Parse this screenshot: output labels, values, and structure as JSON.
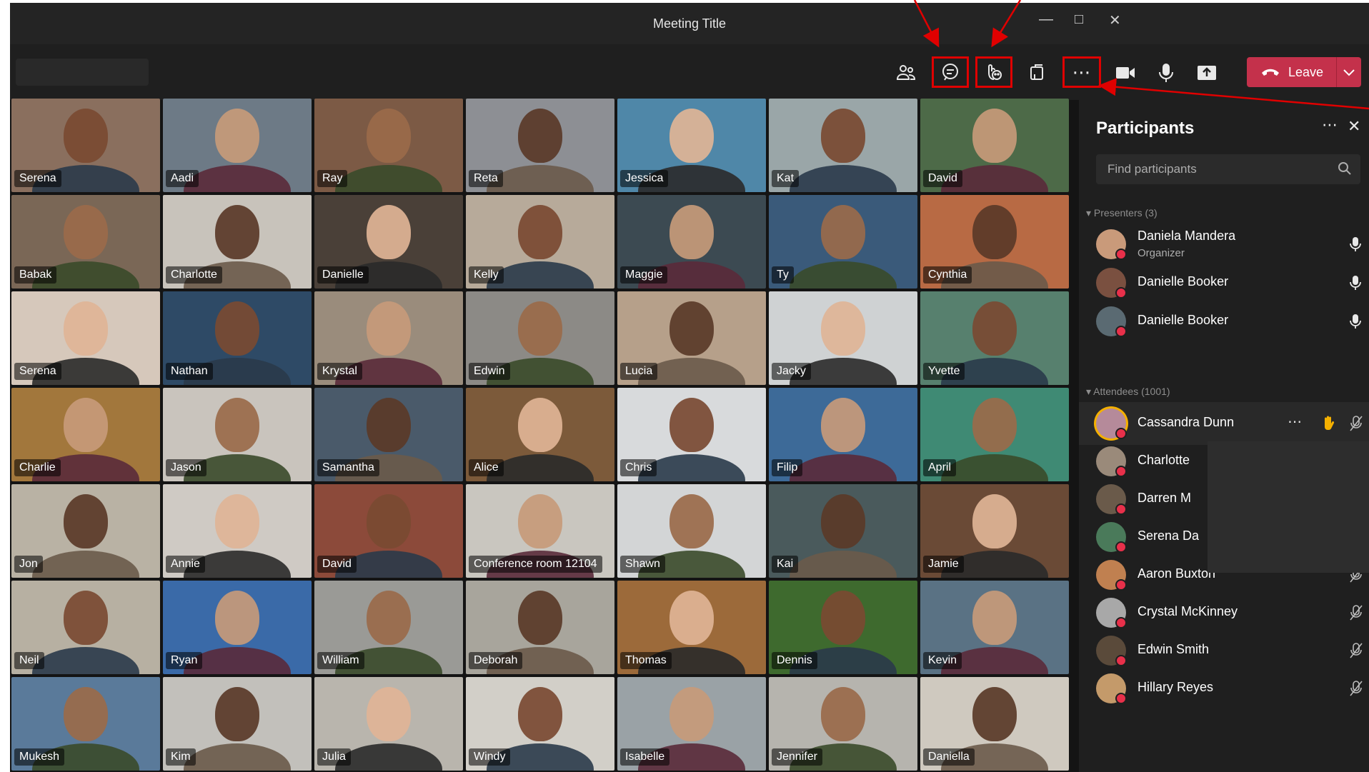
{
  "window": {
    "title": "Meeting Title"
  },
  "toolbar": {
    "buttons": [
      {
        "icon": "people-icon"
      },
      {
        "icon": "chat-icon",
        "highlighted": true
      },
      {
        "icon": "reactions-icon",
        "highlighted": true
      },
      {
        "icon": "rooms-icon"
      },
      {
        "icon": "more-icon",
        "highlighted": true
      },
      {
        "icon": "camera-icon"
      },
      {
        "icon": "mic-icon"
      },
      {
        "icon": "share-icon"
      }
    ],
    "leave_label": "Leave"
  },
  "grid": {
    "tiles": [
      {
        "name": "Serena",
        "bg": "#8a6f5e"
      },
      {
        "name": "Aadi",
        "bg": "#6d7a86"
      },
      {
        "name": "Ray",
        "bg": "#7c5a45"
      },
      {
        "name": "Reta",
        "bg": "#8d8f94"
      },
      {
        "name": "Jessica",
        "bg": "#4f87a8"
      },
      {
        "name": "Kat",
        "bg": "#9aa6a8"
      },
      {
        "name": "David",
        "bg": "#4d6a48"
      },
      {
        "name": "Babak",
        "bg": "#7a6756"
      },
      {
        "name": "Charlotte",
        "bg": "#c8c3bb"
      },
      {
        "name": "Danielle",
        "bg": "#4a4038"
      },
      {
        "name": "Kelly",
        "bg": "#b7aa9a"
      },
      {
        "name": "Maggie",
        "bg": "#3c4a52"
      },
      {
        "name": "Ty",
        "bg": "#3a5a7a"
      },
      {
        "name": "Cynthia",
        "bg": "#b86a44"
      },
      {
        "name": "Serena",
        "bg": "#d6c8bb"
      },
      {
        "name": "Nathan",
        "bg": "#2e4a66"
      },
      {
        "name": "Krystal",
        "bg": "#9a8c7c"
      },
      {
        "name": "Edwin",
        "bg": "#8c8a86"
      },
      {
        "name": "Lucia",
        "bg": "#b6a08a"
      },
      {
        "name": "Jacky",
        "bg": "#cfd2d3"
      },
      {
        "name": "Yvette",
        "bg": "#57806e"
      },
      {
        "name": "Charlie",
        "bg": "#a2773c"
      },
      {
        "name": "Jason",
        "bg": "#c9c4bd"
      },
      {
        "name": "Samantha",
        "bg": "#4a5a6a"
      },
      {
        "name": "Alice",
        "bg": "#7c5a3a"
      },
      {
        "name": "Chris",
        "bg": "#d8dadc"
      },
      {
        "name": "Filip",
        "bg": "#3d6a98"
      },
      {
        "name": "April",
        "bg": "#3f8a74"
      },
      {
        "name": "Jon",
        "bg": "#b9b2a4"
      },
      {
        "name": "Annie",
        "bg": "#cfcac4"
      },
      {
        "name": "David",
        "bg": "#8c4a3a"
      },
      {
        "name": "Conference room 12104",
        "bg": "#c9c6bf"
      },
      {
        "name": "Shawn",
        "bg": "#d3d5d6"
      },
      {
        "name": "Kai",
        "bg": "#4a5a5c"
      },
      {
        "name": "Jamie",
        "bg": "#6a4a36"
      },
      {
        "name": "Neil",
        "bg": "#b7b0a2"
      },
      {
        "name": "Ryan",
        "bg": "#3a6aa8"
      },
      {
        "name": "William",
        "bg": "#9a9a96"
      },
      {
        "name": "Deborah",
        "bg": "#a8a59c"
      },
      {
        "name": "Thomas",
        "bg": "#9c6a3a"
      },
      {
        "name": "Dennis",
        "bg": "#3e6a2e"
      },
      {
        "name": "Kevin",
        "bg": "#5a7284"
      },
      {
        "name": "Mukesh",
        "bg": "#5a7a9a"
      },
      {
        "name": "Kim",
        "bg": "#c2c0bb"
      },
      {
        "name": "Julia",
        "bg": "#b9b5ad"
      },
      {
        "name": "Windy",
        "bg": "#d2cfc8"
      },
      {
        "name": "Isabelle",
        "bg": "#9aa2a6"
      },
      {
        "name": "Jennifer",
        "bg": "#b6b4ae"
      },
      {
        "name": "Daniella",
        "bg": "#cfc9bf"
      }
    ]
  },
  "panel": {
    "title": "Participants",
    "search_placeholder": "Find participants",
    "presenters_header": "Presenters (3)",
    "attendees_header": "Attendees (1001)",
    "presenters": [
      {
        "name": "Daniela Mandera",
        "role": "Organizer",
        "avatar": "#c99a7a"
      },
      {
        "name": "Danielle Booker",
        "role": "",
        "avatar": "#7a5040"
      },
      {
        "name": "Danielle Booker",
        "role": "",
        "avatar": "#5a6a72"
      }
    ],
    "attendees": [
      {
        "name": "Cassandra Dunn",
        "avatar": "#b58a9a"
      },
      {
        "name": "Charlotte",
        "avatar": "#9a8a7a"
      },
      {
        "name": "Darren M",
        "avatar": "#6a5a4a"
      },
      {
        "name": "Serena Da",
        "avatar": "#4a7a5a"
      },
      {
        "name": "Aaron Buxton",
        "avatar": "#c08050"
      },
      {
        "name": "Crystal McKinney",
        "avatar": "#a8a8a8"
      },
      {
        "name": "Edwin Smith",
        "avatar": "#5a4a3a"
      },
      {
        "name": "Hillary Reyes",
        "avatar": "#c49a6a"
      }
    ]
  },
  "colors": {
    "accent_leave": "#c4314b",
    "annotation": "#e00000",
    "hand": "#f4b000",
    "status_dot": "#e8304a"
  }
}
